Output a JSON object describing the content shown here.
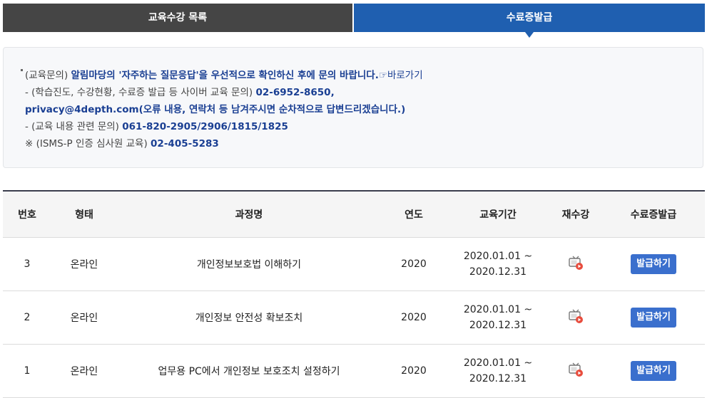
{
  "tabs": [
    {
      "label": "교육수강 목록",
      "active": false
    },
    {
      "label": "수료증발급",
      "active": true
    }
  ],
  "notice": {
    "line1_prefix": "(교육문의)",
    "line1_bold": "알림마당의 '자주하는 질문응답'을 우선적으로 확인하신 후에 문의 바랍니다.",
    "line1_link": "☞바로가기",
    "line2_prefix": "- (학습진도, 수강현황, 수료증 발급 등 사이버 교육 문의)",
    "line2_bold": "02-6952-8650,",
    "line3_bold": "privacy@4depth.com(오류 내용, 연락처 등 남겨주시면 순차적으로 답변드리겠습니다.)",
    "line4_prefix": "- (교육 내용 관련 문의)",
    "line4_bold": "061-820-2905/2906/1815/1825",
    "line5_prefix": "※ (ISMS-P 인증 심사원 교육)",
    "line5_bold": "02-405-5283"
  },
  "table": {
    "headers": [
      "번호",
      "형태",
      "과정명",
      "연도",
      "교육기간",
      "재수강",
      "수료증발급"
    ],
    "rows": [
      {
        "no": "3",
        "type": "온라인",
        "course": "개인정보보호법 이해하기",
        "year": "2020",
        "period_start": "2020.01.01 ~",
        "period_end": "2020.12.31",
        "button": "발급하기"
      },
      {
        "no": "2",
        "type": "온라인",
        "course": "개인정보 안전성 확보조치",
        "year": "2020",
        "period_start": "2020.01.01 ~",
        "period_end": "2020.12.31",
        "button": "발급하기"
      },
      {
        "no": "1",
        "type": "온라인",
        "course": "업무용 PC에서 개인정보 보호조치 설정하기",
        "year": "2020",
        "period_start": "2020.01.01 ~",
        "period_end": "2020.12.31",
        "button": "발급하기"
      }
    ]
  },
  "colors": {
    "active_tab": "#1f5fb0",
    "inactive_tab": "#454545",
    "button": "#3a6fcd",
    "emphasis": "#1a3f93",
    "icon_accent": "#e84c3d"
  },
  "icons": {
    "retake": "tv-play-icon"
  }
}
